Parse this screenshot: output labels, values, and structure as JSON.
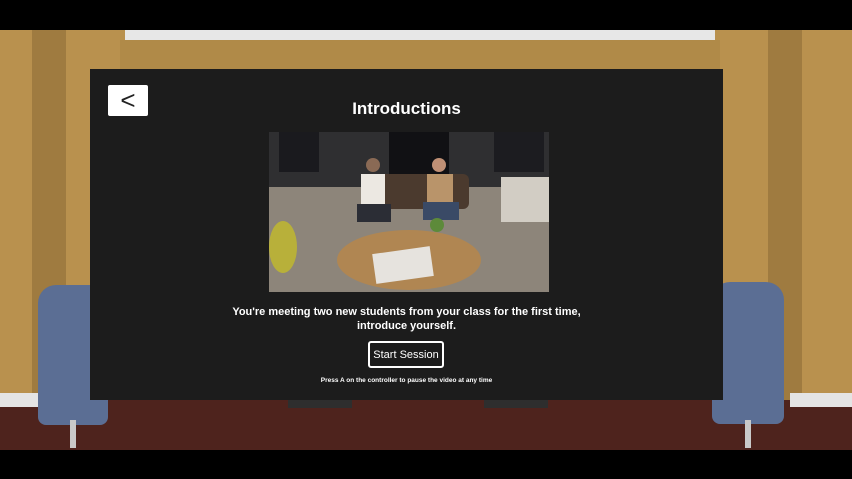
{
  "panel": {
    "back_label": "<",
    "title": "Introductions",
    "description_line1": "You're meeting two new students from your class for the first time,",
    "description_line2": "introduce yourself.",
    "start_button_label": "Start Session",
    "hint": "Press A on the controller to pause the video at any time"
  },
  "colors": {
    "panel_bg": "#1c1c1c",
    "wall": "#b9914e",
    "floor": "#4e231d",
    "chair": "#5b6e94"
  }
}
